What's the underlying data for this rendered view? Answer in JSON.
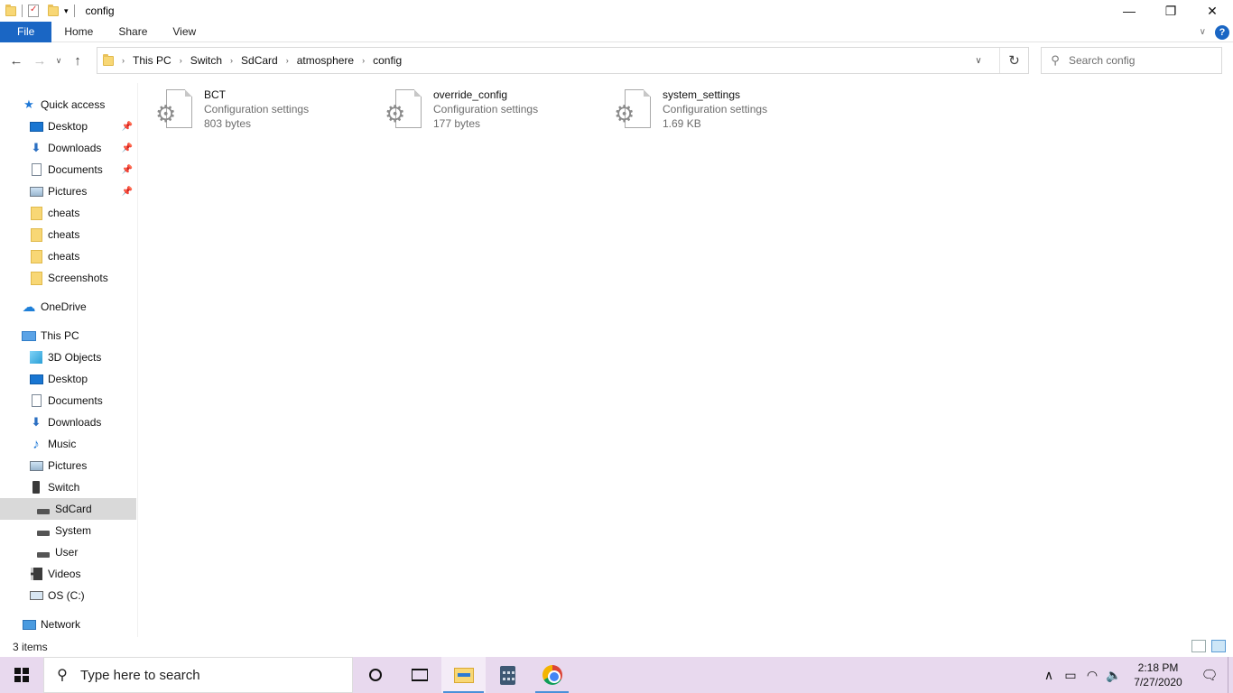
{
  "window": {
    "title": "config",
    "quick_access_dropdown": "▾"
  },
  "ribbon": {
    "tabs": [
      "File",
      "Home",
      "Share",
      "View"
    ]
  },
  "address": {
    "crumbs": [
      "This PC",
      "Switch",
      "SdCard",
      "atmosphere",
      "config"
    ]
  },
  "search": {
    "placeholder": "Search config"
  },
  "nav": {
    "quick_access_label": "Quick access",
    "quick_items": [
      {
        "label": "Desktop",
        "icon": "desktop-icon",
        "pinned": true
      },
      {
        "label": "Downloads",
        "icon": "downloads-icon",
        "pinned": true
      },
      {
        "label": "Documents",
        "icon": "documents-icon",
        "pinned": true
      },
      {
        "label": "Pictures",
        "icon": "pictures-icon",
        "pinned": true
      },
      {
        "label": "cheats",
        "icon": "folder-icon",
        "pinned": false
      },
      {
        "label": "cheats",
        "icon": "folder-icon",
        "pinned": false
      },
      {
        "label": "cheats",
        "icon": "folder-icon",
        "pinned": false
      },
      {
        "label": "Screenshots",
        "icon": "folder-icon",
        "pinned": false
      }
    ],
    "onedrive_label": "OneDrive",
    "thispc_label": "This PC",
    "pc_items": [
      {
        "label": "3D Objects",
        "icon": "3d-objects-icon"
      },
      {
        "label": "Desktop",
        "icon": "desktop-icon"
      },
      {
        "label": "Documents",
        "icon": "documents-icon"
      },
      {
        "label": "Downloads",
        "icon": "downloads-icon"
      },
      {
        "label": "Music",
        "icon": "music-icon"
      },
      {
        "label": "Pictures",
        "icon": "pictures-icon"
      },
      {
        "label": "Switch",
        "icon": "phone-icon"
      }
    ],
    "switch_items": [
      {
        "label": "SdCard",
        "selected": true
      },
      {
        "label": "System",
        "selected": false
      },
      {
        "label": "User",
        "selected": false
      }
    ],
    "pc_items_after": [
      {
        "label": "Videos",
        "icon": "videos-icon"
      },
      {
        "label": "OS (C:)",
        "icon": "os-drive-icon"
      }
    ],
    "network_label": "Network"
  },
  "files": [
    {
      "name": "BCT",
      "type": "Configuration settings",
      "size": "803 bytes"
    },
    {
      "name": "override_config",
      "type": "Configuration settings",
      "size": "177 bytes"
    },
    {
      "name": "system_settings",
      "type": "Configuration settings",
      "size": "1.69 KB"
    }
  ],
  "status": {
    "item_count": "3 items"
  },
  "taskbar": {
    "search_text": "Type here to search",
    "time": "2:18 PM",
    "date": "7/27/2020"
  }
}
